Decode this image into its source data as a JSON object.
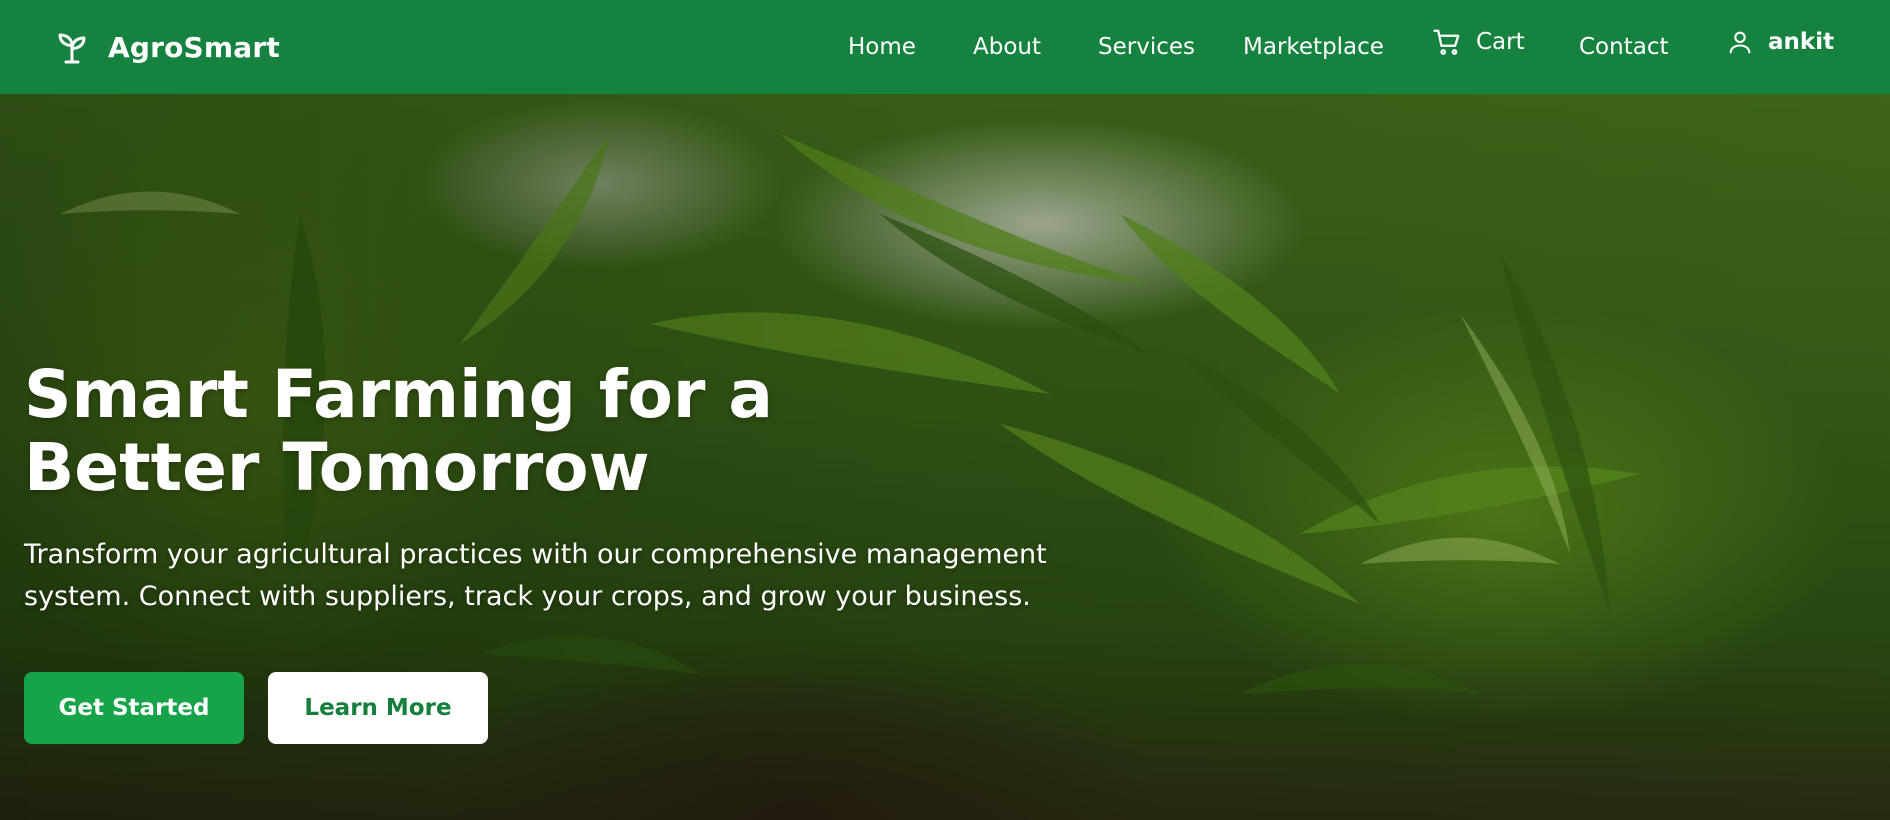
{
  "brand": {
    "name": "AgroSmart",
    "icon": "sprout-icon"
  },
  "nav": {
    "items": [
      {
        "label": "Home"
      },
      {
        "label": "About"
      },
      {
        "label": "Services"
      },
      {
        "label": "Marketplace"
      },
      {
        "label": "Cart",
        "icon": "cart-icon"
      },
      {
        "label": "Contact"
      }
    ],
    "user": {
      "name": "ankit",
      "icon": "user-icon"
    }
  },
  "hero": {
    "title": "Smart Farming for a Better Tomorrow",
    "subtitle": "Transform your agricultural practices with our comprehensive management system. Connect with suppliers, track your crops, and grow your business.",
    "primary_button": "Get Started",
    "secondary_button": "Learn More"
  },
  "colors": {
    "nav_background": "#16823f",
    "primary_button": "#16a34a",
    "secondary_button_text": "#15803d",
    "text_light": "#ffffff"
  }
}
